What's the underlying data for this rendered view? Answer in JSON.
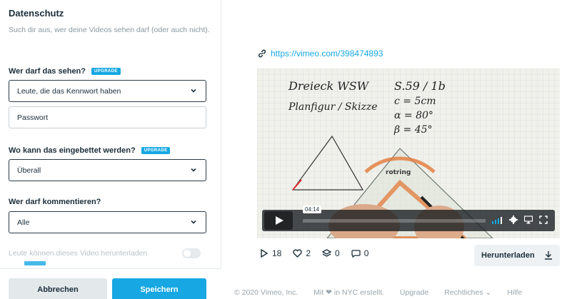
{
  "privacy": {
    "title": "Datenschutz",
    "description": "Such dir aus, wer deine Videos sehen darf (oder auch nicht).",
    "view": {
      "label": "Wer darf das sehen?",
      "badge": "UPGRADE",
      "selected": "Leute, die das Kennwort haben",
      "password": "Passwort"
    },
    "embed": {
      "label": "Wo kann das eingebettet werden?",
      "badge": "UPGRADE",
      "selected": "Überall"
    },
    "comments": {
      "label": "Wer darf kommentieren?",
      "selected": "Alle"
    },
    "download": {
      "label": "Leute können dieses Video herunterladen",
      "enabled": false
    },
    "cancel_label": "Abbrechen",
    "save_label": "Speichern"
  },
  "video": {
    "url": "https://vimeo.com/398474893",
    "time_tooltip": "04:14",
    "whiteboard": {
      "line1": "Dreieck WSW",
      "line1b": "S.59 / 1b",
      "line2": "Planfigur / Skizze",
      "line2b": "c = 5cm",
      "line3": "α = 80°",
      "line4": "β = 45°",
      "ruler_brand": "rotring"
    }
  },
  "stats": {
    "plays": "18",
    "likes": "2",
    "collections": "0",
    "comments": "0"
  },
  "download_label": "Herunterladen",
  "site_footer": {
    "copyright": "© 2020 Vimeo, Inc.",
    "made_in": "Mit ❤ in NYC erstellt.",
    "upgrade": "Upgrade",
    "legal": "Rechtliches ⌄",
    "help": "Hilfe"
  },
  "colors": {
    "accent": "#17a8e3",
    "text": "#1a2e3b",
    "muted": "#8a97a0"
  }
}
